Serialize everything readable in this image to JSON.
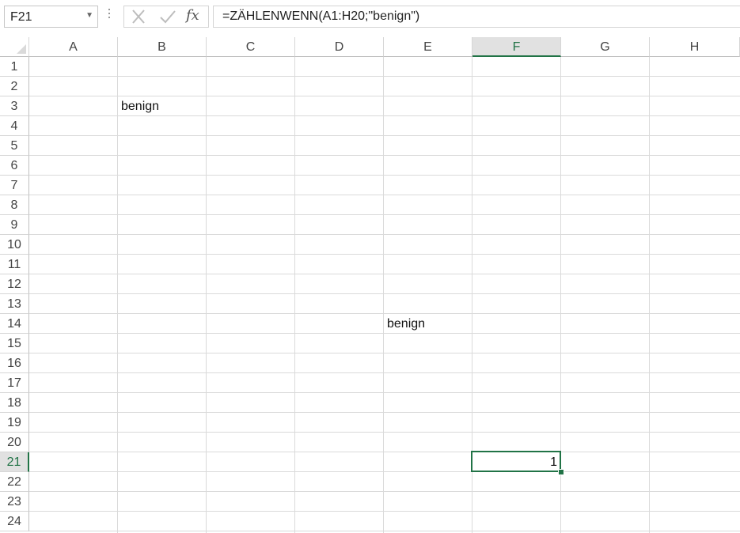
{
  "name_box": {
    "value": "F21",
    "dropdown_icon": "chevron-down-icon"
  },
  "formula_bar": {
    "cancel_icon": "cancel-x-icon",
    "enter_icon": "checkmark-icon",
    "function_label": "fx",
    "formula": "=ZÄHLENWENN(A1:H20;\"benign\")"
  },
  "columns": [
    {
      "label": "A"
    },
    {
      "label": "B"
    },
    {
      "label": "C"
    },
    {
      "label": "D"
    },
    {
      "label": "E"
    },
    {
      "label": "F",
      "selected": true
    },
    {
      "label": "G"
    },
    {
      "label": "H"
    }
  ],
  "rows": [
    "1",
    "2",
    "3",
    "4",
    "5",
    "6",
    "7",
    "8",
    "9",
    "10",
    "11",
    "12",
    "13",
    "14",
    "15",
    "16",
    "17",
    "18",
    "19",
    "20",
    "21",
    "22",
    "23",
    "24"
  ],
  "selected_row": "21",
  "cells": {
    "B3": "benign",
    "E14": "benign",
    "F21": "1"
  },
  "active_cell": "F21",
  "colors": {
    "selection": "#217346",
    "header_selected_bg": "#e1e1e1",
    "gridline": "#dadada"
  }
}
